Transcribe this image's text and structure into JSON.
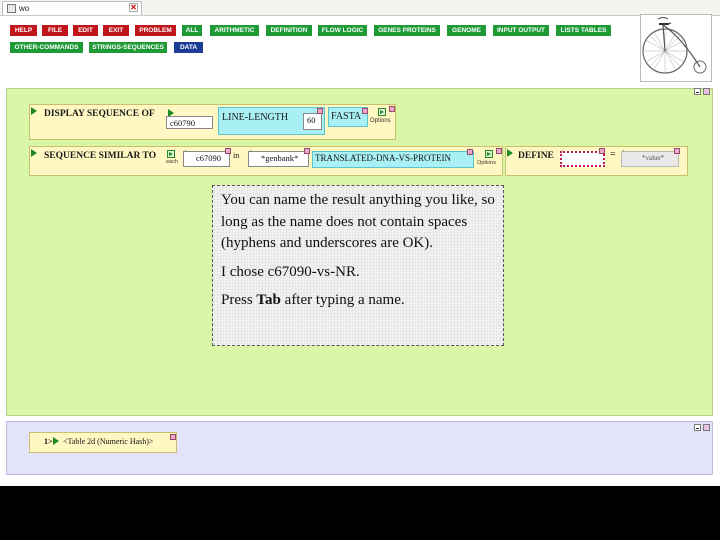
{
  "window": {
    "tab_title": "wo",
    "tab_close": "✕"
  },
  "menu": {
    "row1": [
      {
        "label": "HELP",
        "color": "red"
      },
      {
        "label": "FILE",
        "color": "red"
      },
      {
        "label": "EDIT",
        "color": "red"
      },
      {
        "label": "EXIT",
        "color": "red"
      },
      {
        "label": "PROBLEM",
        "color": "red"
      },
      {
        "label": "ALL",
        "color": "green"
      },
      {
        "label": "ARITHMETIC",
        "color": "green"
      },
      {
        "label": "DEFINITION",
        "color": "green"
      },
      {
        "label": "FLOW LOGIC",
        "color": "green"
      },
      {
        "label": "GENES PROTEINS",
        "color": "green"
      },
      {
        "label": "GENOME",
        "color": "green"
      },
      {
        "label": "INPUT OUTPUT",
        "color": "green"
      },
      {
        "label": "LISTS TABLES",
        "color": "green"
      }
    ],
    "row2": [
      {
        "label": "OTHER-COMMANDS",
        "color": "green"
      },
      {
        "label": "STRINGS-SEQUENCES",
        "color": "green"
      },
      {
        "label": "DATA",
        "color": "blue"
      }
    ]
  },
  "colors": {
    "red": "#c0151b",
    "green": "#1e9a36",
    "blue": "#1c3c96",
    "main_panel": "#d9f7a6",
    "result_panel": "#e3e3fa"
  },
  "icons": [
    "back-arrow-icon",
    "forward-arrow-icon",
    "green-arrow-icon",
    "close-x-icon",
    "minimize-icon",
    "maximize-icon",
    "penny-farthing-logo"
  ],
  "display_block": {
    "label": "DISPLAY SEQUENCE OF",
    "arg": "c60790",
    "option_label": "LINE-LENGTH",
    "option_value": "60",
    "format": "FASTA",
    "options": "Options"
  },
  "similar_block": {
    "label": "SEQUENCE SIMILAR TO",
    "each": "each",
    "arg": "c67090",
    "in": "in",
    "db": "*genbank*",
    "method": "TRANSLATED-DNA-VS-PROTEIN",
    "options": "Options"
  },
  "define_block": {
    "label": "DEFINE",
    "equals": "=",
    "value": "*value*"
  },
  "tooltip": {
    "p1": "You can name the result anything you like, so long as the name does not contain spaces (hyphens and underscores are OK).",
    "p2": "I chose c67090-vs-NR.",
    "p3_pre": "Press ",
    "p3_key": "Tab",
    "p3_post": " after typing a name."
  },
  "result": {
    "index": "1>",
    "value": "<Table 2d (Numeric Hash)>"
  }
}
